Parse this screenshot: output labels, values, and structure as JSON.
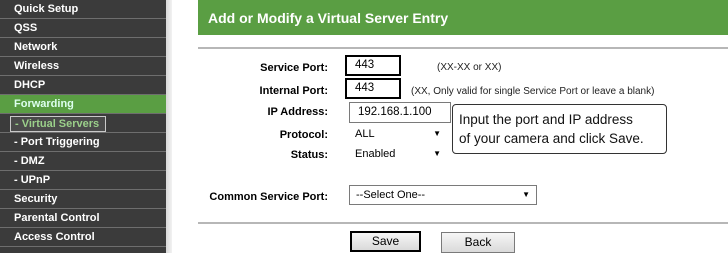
{
  "sidebar": {
    "items": [
      {
        "label": "Quick Setup"
      },
      {
        "label": "QSS"
      },
      {
        "label": "Network"
      },
      {
        "label": "Wireless"
      },
      {
        "label": "DHCP"
      },
      {
        "label": "Forwarding"
      },
      {
        "label": "- Virtual Servers"
      },
      {
        "label": "- Port Triggering"
      },
      {
        "label": "- DMZ"
      },
      {
        "label": "- UPnP"
      },
      {
        "label": "Security"
      },
      {
        "label": "Parental Control"
      },
      {
        "label": "Access Control"
      }
    ]
  },
  "header": {
    "title": "Add or Modify a Virtual Server Entry"
  },
  "form": {
    "service_port": {
      "label": "Service Port:",
      "value": "443",
      "hint": "(XX-XX or XX)"
    },
    "internal_port": {
      "label": "Internal Port:",
      "value": "443",
      "hint": "(XX, Only valid for single Service Port or leave a blank)"
    },
    "ip_address": {
      "label": "IP Address:",
      "value": "192.168.1.100"
    },
    "protocol": {
      "label": "Protocol:",
      "value": "ALL"
    },
    "status": {
      "label": "Status:",
      "value": "Enabled"
    },
    "common_service_port": {
      "label": "Common Service Port:",
      "value": "--Select One--"
    }
  },
  "callout": {
    "line1": "Input the port and IP address",
    "line2": "of your camera and click Save."
  },
  "buttons": {
    "save": "Save",
    "back": "Back"
  },
  "colors": {
    "accent": "#5a9e43",
    "sidebar_bg": "#3b3b3b"
  }
}
